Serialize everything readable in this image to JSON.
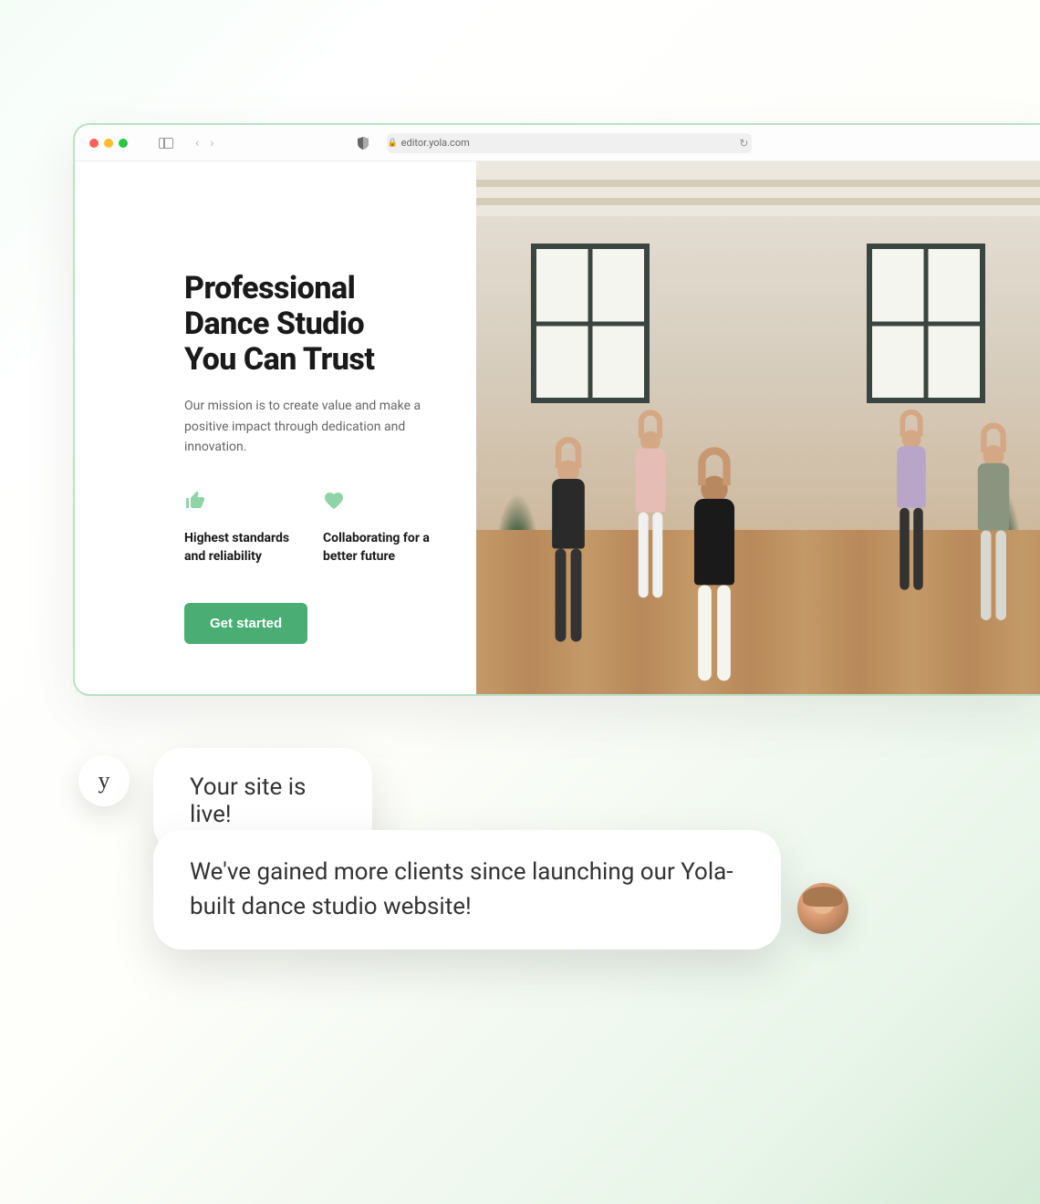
{
  "browser": {
    "url": "editor.yola.com"
  },
  "hero": {
    "title_line1": "Professional",
    "title_line2": "Dance Studio",
    "title_line3": "You Can Trust",
    "subtitle": "Our mission is to create value and make a positive impact through dedication and innovation."
  },
  "features": [
    {
      "icon": "thumbs-up-icon",
      "text": "Highest standards and reliability"
    },
    {
      "icon": "heart-icon",
      "text": "Collaborating for a better future"
    }
  ],
  "cta": {
    "label": "Get started"
  },
  "chat": {
    "yola_avatar_label": "y",
    "message_1": "Your site is live!",
    "message_2": "We've gained more clients since launching our Yola-built dance studio website!"
  },
  "colors": {
    "accent_green": "#4aad73",
    "icon_green": "#8fd3a8",
    "border_green": "#b8e0c5"
  }
}
